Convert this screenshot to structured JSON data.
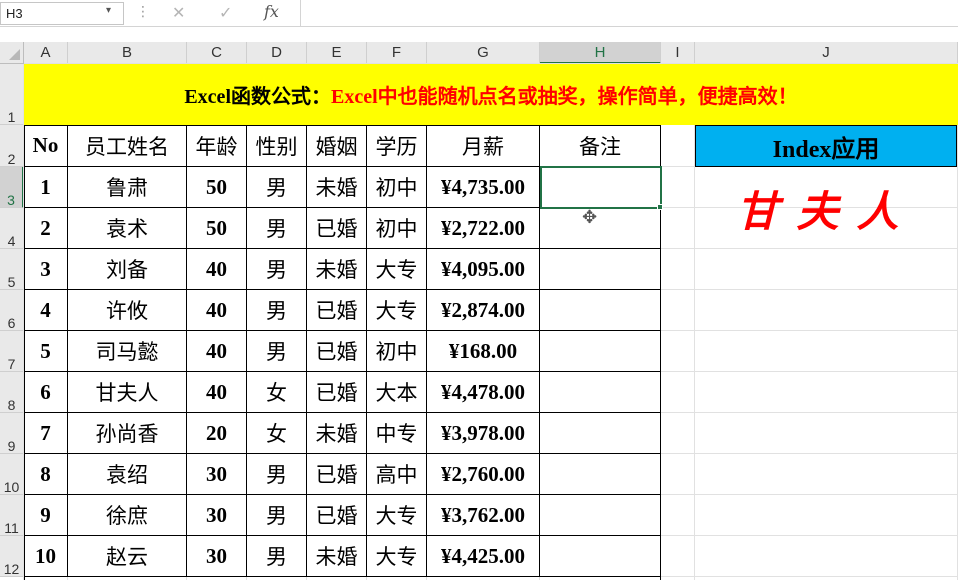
{
  "formula_bar": {
    "name_box": "H3",
    "formula": "",
    "cancel_glyph": "✕",
    "enter_glyph": "✓",
    "fx_glyph": "fx",
    "dots_glyph": "⋮"
  },
  "columns": [
    "A",
    "B",
    "C",
    "D",
    "E",
    "F",
    "G",
    "H",
    "I",
    "J"
  ],
  "selected_column": "H",
  "rows": [
    "1",
    "2",
    "3",
    "4",
    "5",
    "6",
    "7",
    "8",
    "9",
    "10",
    "11",
    "12"
  ],
  "selected_row": "3",
  "banner": {
    "prefix": "Excel函数公式：",
    "text": "Excel中也能随机点名或抽奖，操作简单，便捷高效！"
  },
  "table": {
    "headers": [
      "No",
      "员工姓名",
      "年龄",
      "性别",
      "婚姻",
      "学历",
      "月薪",
      "备注"
    ],
    "rows": [
      [
        "1",
        "鲁肃",
        "50",
        "男",
        "未婚",
        "初中",
        "¥4,735.00",
        ""
      ],
      [
        "2",
        "袁术",
        "50",
        "男",
        "已婚",
        "初中",
        "¥2,722.00",
        ""
      ],
      [
        "3",
        "刘备",
        "40",
        "男",
        "未婚",
        "大专",
        "¥4,095.00",
        ""
      ],
      [
        "4",
        "许攸",
        "40",
        "男",
        "已婚",
        "大专",
        "¥2,874.00",
        ""
      ],
      [
        "5",
        "司马懿",
        "40",
        "男",
        "已婚",
        "初中",
        "¥168.00",
        ""
      ],
      [
        "6",
        "甘夫人",
        "40",
        "女",
        "已婚",
        "大本",
        "¥4,478.00",
        ""
      ],
      [
        "7",
        "孙尚香",
        "20",
        "女",
        "未婚",
        "中专",
        "¥3,978.00",
        ""
      ],
      [
        "8",
        "袁绍",
        "30",
        "男",
        "已婚",
        "高中",
        "¥2,760.00",
        ""
      ],
      [
        "9",
        "徐庶",
        "30",
        "男",
        "已婚",
        "大专",
        "¥3,762.00",
        ""
      ],
      [
        "10",
        "赵云",
        "30",
        "男",
        "未婚",
        "大专",
        "¥4,425.00",
        ""
      ]
    ]
  },
  "index_panel": {
    "title": "Index应用",
    "result": "甘夫人"
  },
  "colors": {
    "banner_bg": "#ffff00",
    "banner_red": "#ff0000",
    "index_header_bg": "#00b0f0",
    "result_red": "#ff0000",
    "selection_green": "#217346"
  },
  "cursor_glyph": "✥"
}
